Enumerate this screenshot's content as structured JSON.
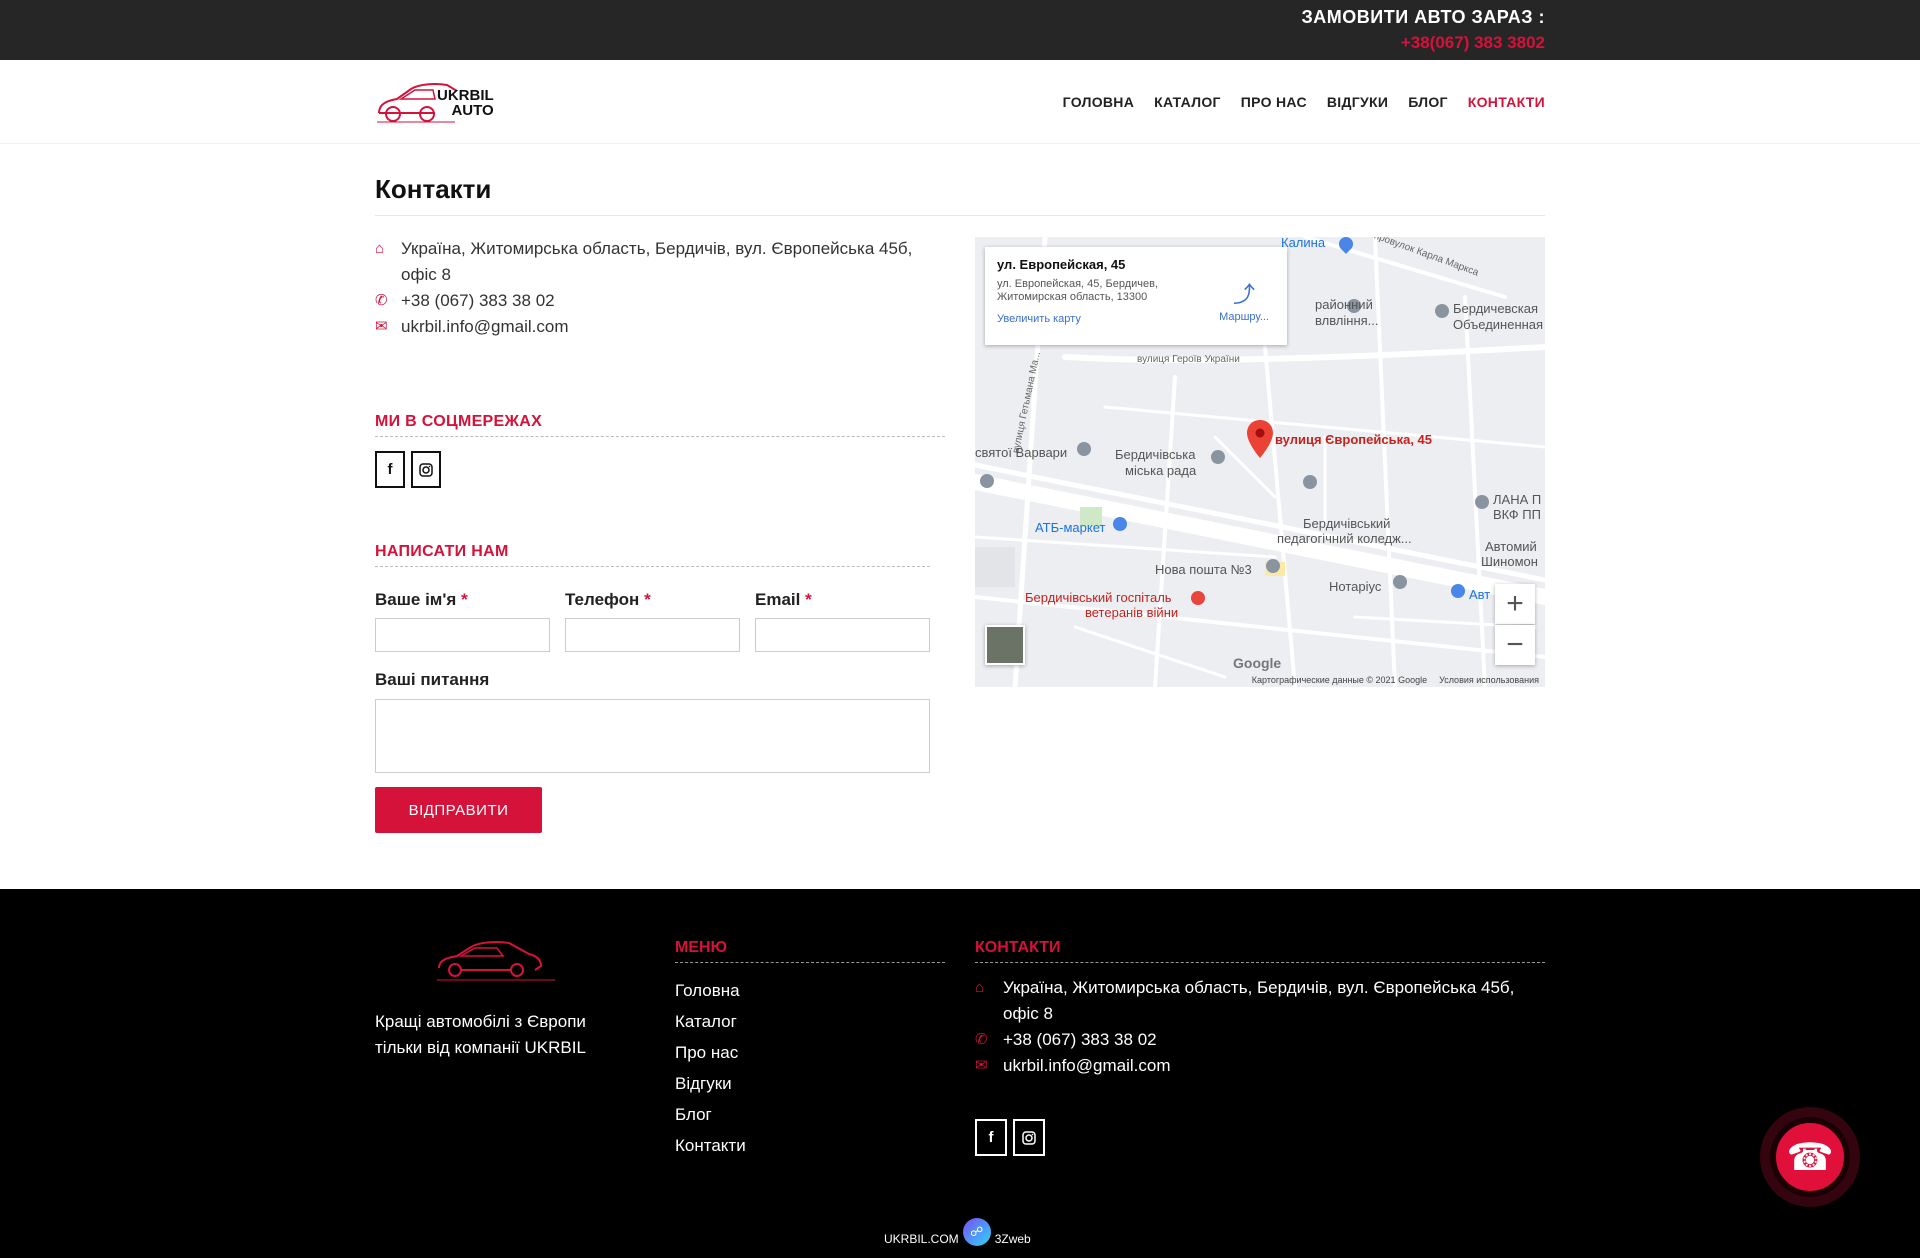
{
  "topbar": {
    "order_label": "ЗАМОВИТИ АВТО ЗАРАЗ :",
    "order_phone": "+38(067) 383 3802"
  },
  "brand": {
    "logo_line1": "UKRBIL",
    "logo_line2": "AUTO",
    "accent": "#d4123a"
  },
  "nav": {
    "items": [
      {
        "label": "ГОЛОВНА"
      },
      {
        "label": "КАТАЛОГ"
      },
      {
        "label": "ПРО НАС"
      },
      {
        "label": "ВІДГУКИ"
      },
      {
        "label": "БЛОГ"
      },
      {
        "label": "КОНТАКТИ",
        "active": true
      }
    ]
  },
  "page": {
    "title": "Контакти"
  },
  "contacts": {
    "address": "Україна, Житомирська область, Бердичів, вул. Європейська 45б, офіс 8",
    "phone": "+38 (067) 383 38 02",
    "email": "ukrbil.info@gmail.com",
    "icons": {
      "address": "home-icon",
      "phone": "phone-icon",
      "email": "envelope-icon"
    }
  },
  "social": {
    "heading": "МИ В СОЦМЕРЕЖАХ",
    "facebook_glyph": "f",
    "instagram_icon": "instagram-icon"
  },
  "form": {
    "heading": "НАПИСАТИ НАМ",
    "name_label": "Ваше ім'я",
    "phone_label": "Телефон",
    "email_label": "Email",
    "required_mark": "*",
    "question_label": "Ваші питання",
    "submit_label": "ВІДПРАВИТИ"
  },
  "map": {
    "card_title": "ул. Европейская, 45",
    "card_address": "ул. Европейская, 45, Бердичев, Житомирская область, 13300",
    "card_link": "Увеличить карту",
    "route_label": "Маршру...",
    "pin_label": "вулиця Європейська, 45",
    "zoom_in": "+",
    "zoom_out": "−",
    "google": "Google",
    "attribution": "Картографические данные © 2021 Google",
    "terms": "Условия использования",
    "labels": {
      "kalyna": "Калина",
      "karl_marx": "провулок Карла Маркса",
      "rayonnyi": "районний",
      "pravlinnia": "влвління...",
      "berdychivska_ob": "Бердичевская",
      "obiednana": "Объединенная",
      "geroiv": "вулиця Героїв України",
      "hetmana": "вулиця Гетьмана Ма...",
      "varvary": "святої Варвари",
      "rada1": "Бердичівська",
      "rada2": "міська рада",
      "atb": "АТБ-маркет",
      "koledzh1": "Бердичівський",
      "koledzh2": "педагогічний коледж...",
      "lana1": "ЛАНА П",
      "lana2": "ВКФ ПП",
      "avtomyi1": "Автомий",
      "avtomyi2": "Шиномон",
      "nova_poshta": "Нова пошта №3",
      "notarius": "Нотаріус",
      "avto": "Авт",
      "hospital1": "Бердичівський госпіталь",
      "hospital2": "ветеранів війни"
    }
  },
  "footer": {
    "about": "Кращі автомобілі з Європи тільки від компанії UKRBIL",
    "menu_heading": "МЕНЮ",
    "menu": [
      "Головна",
      "Каталог",
      "Про нас",
      "Відгуки",
      "Блог",
      "Контакти"
    ],
    "contacts_heading": "КОНТАКТИ",
    "address": "Україна, Житомирська область, Бердичів, вул. Європейська 45б, офіс 8",
    "phone": "+38 (067) 383 38 02",
    "email": "ukrbil.info@gmail.com",
    "copyright": "UKRBIL.COM",
    "dev": "3Zweb"
  }
}
